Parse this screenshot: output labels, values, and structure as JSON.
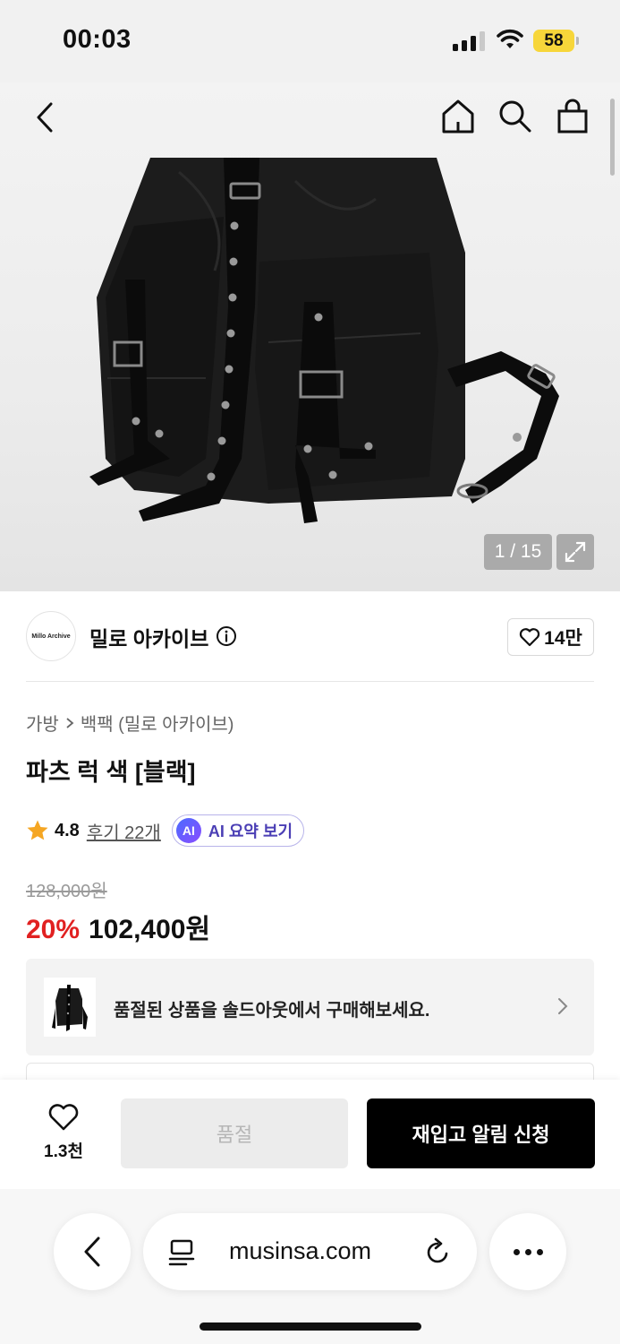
{
  "status_bar": {
    "time": "00:03",
    "battery": "58"
  },
  "gallery": {
    "counter": "1 / 15"
  },
  "brand": {
    "logo_text": "Millo Archive",
    "name": "밀로 아카이브",
    "likes": "14만"
  },
  "breadcrumb": {
    "category": "가방",
    "subcategory": "백팩 (밀로 아카이브)"
  },
  "product": {
    "title": "파츠 럭 색 [블랙]",
    "rating": "4.8",
    "reviews": "후기 22개",
    "ai_badge": "AI",
    "ai_summary": "AI 요약 보기",
    "original_price": "128,000원",
    "discount": "20%",
    "price": "102,400원"
  },
  "soldout_banner": {
    "text": "품절된 상품을 솔드아웃에서 구매해보세요."
  },
  "action_bar": {
    "wish_count": "1.3천",
    "soldout_label": "품절",
    "restock_label": "재입고 알림 신청"
  },
  "browser": {
    "url": "musinsa.com"
  },
  "colors": {
    "discount": "#e12121",
    "primary_button": "#000000",
    "ai_accent": "#4b3fb5"
  }
}
